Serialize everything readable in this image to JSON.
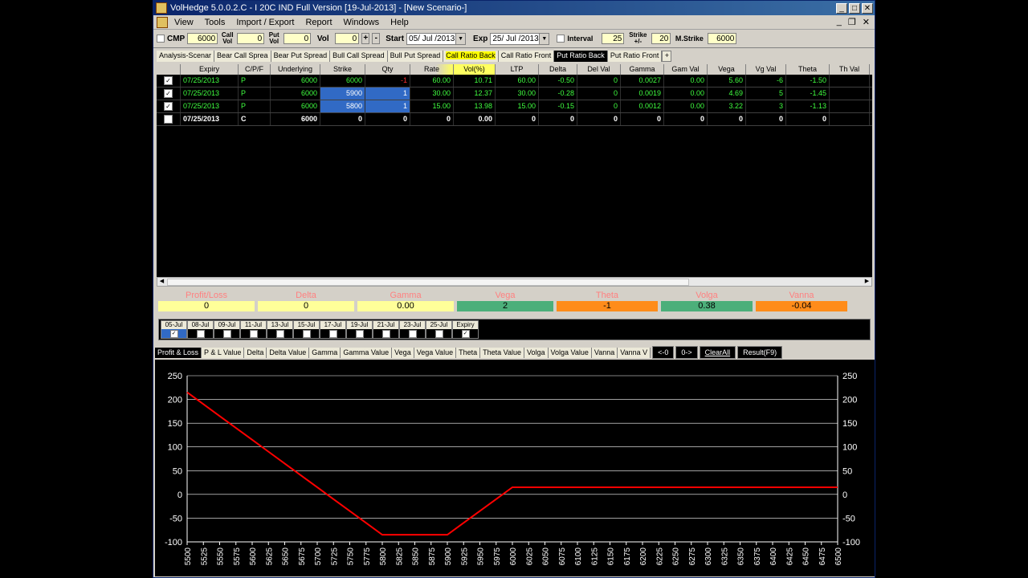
{
  "window": {
    "title": "VolHedge 5.0.0.2.C - I 20C IND Full Version  [19-Jul-2013]  - [New Scenario-]"
  },
  "menu": {
    "items": [
      "View",
      "Tools",
      "Import / Export",
      "Report",
      "Windows",
      "Help"
    ]
  },
  "toolbar": {
    "cmp_label": "CMP",
    "cmp_value": "6000",
    "callvol_label": "Call Vol",
    "callvol_value": "0",
    "putvol_label": "Put Vol",
    "putvol_value": "0",
    "vol_label": "Vol",
    "vol_value": "0",
    "plus": "+",
    "minus": "-",
    "start_label": "Start",
    "start_value": "05/ Jul /2013",
    "exp_label": "Exp",
    "exp_value": "25/ Jul /2013",
    "interval_label": "Interval",
    "interval_value": "25",
    "strike_label": "Strike +/-",
    "strike_value": "20",
    "mstrike_label": "M.Strike",
    "mstrike_value": "6000"
  },
  "strategy_tabs": [
    "Analysis-Scenar",
    "Bear Call Sprea",
    "Bear Put Spread",
    "Bull Call Spread",
    "Bull Put Spread",
    "Call Ratio Back",
    "Call Ratio Front",
    "Put Ratio Back",
    "Put Ratio Front",
    "+"
  ],
  "grid": {
    "columns": [
      "",
      "Expiry",
      "C/P/F",
      "Underlying",
      "Strike",
      "Qty",
      "Rate",
      "Vol(%)",
      "LTP",
      "Delta",
      "Del Val",
      "Gamma",
      "Gam Val",
      "Vega",
      "Vg Val",
      "Theta",
      "Th Val"
    ],
    "rows": [
      {
        "checked": true,
        "expiry": "07/25/2013",
        "cpf": "P",
        "underlying": "6000",
        "strike": "6000",
        "qty": "-1",
        "rate": "60.00",
        "vol": "10.71",
        "ltp": "60.00",
        "delta": "-0.50",
        "delval": "0",
        "gamma": "0.0027",
        "gamval": "0.00",
        "vega": "5.60",
        "vgval": "-6",
        "theta": "-1.50",
        "thval": ""
      },
      {
        "checked": true,
        "expiry": "07/25/2013",
        "cpf": "P",
        "underlying": "6000",
        "strike": "5900",
        "qty": "1",
        "rate": "30.00",
        "vol": "12.37",
        "ltp": "30.00",
        "delta": "-0.28",
        "delval": "0",
        "gamma": "0.0019",
        "gamval": "0.00",
        "vega": "4.69",
        "vgval": "5",
        "theta": "-1.45",
        "thval": ""
      },
      {
        "checked": true,
        "expiry": "07/25/2013",
        "cpf": "P",
        "underlying": "6000",
        "strike": "5800",
        "qty": "1",
        "rate": "15.00",
        "vol": "13.98",
        "ltp": "15.00",
        "delta": "-0.15",
        "delval": "0",
        "gamma": "0.0012",
        "gamval": "0.00",
        "vega": "3.22",
        "vgval": "3",
        "theta": "-1.13",
        "thval": ""
      },
      {
        "checked": false,
        "expiry": "07/25/2013",
        "cpf": "C",
        "underlying": "6000",
        "strike": "0",
        "qty": "0",
        "rate": "0",
        "vol": "0.00",
        "ltp": "0",
        "delta": "0",
        "delval": "0",
        "gamma": "0",
        "gamval": "0",
        "vega": "0",
        "vgval": "0",
        "theta": "0",
        "thval": ""
      }
    ]
  },
  "greeks": [
    {
      "label": "Profit/Loss",
      "value": "0",
      "color": "#ffff99"
    },
    {
      "label": "Delta",
      "value": "0",
      "color": "#ffff99"
    },
    {
      "label": "Gamma",
      "value": "0.00",
      "color": "#ffff99"
    },
    {
      "label": "Vega",
      "value": "2",
      "color": "#4caf7a"
    },
    {
      "label": "Theta",
      "value": "-1",
      "color": "#ff8c1a"
    },
    {
      "label": "Volga",
      "value": "0.38",
      "color": "#4caf7a"
    },
    {
      "label": "Vanna",
      "value": "-0.04",
      "color": "#ff8c1a"
    }
  ],
  "dates": [
    {
      "label": "05-Jul",
      "checked": true,
      "selected": true
    },
    {
      "label": "08-Jul",
      "checked": false
    },
    {
      "label": "09-Jul",
      "checked": false
    },
    {
      "label": "11-Jul",
      "checked": false
    },
    {
      "label": "13-Jul",
      "checked": false
    },
    {
      "label": "15-Jul",
      "checked": false
    },
    {
      "label": "17-Jul",
      "checked": false
    },
    {
      "label": "19-Jul",
      "checked": false
    },
    {
      "label": "21-Jul",
      "checked": false
    },
    {
      "label": "23-Jul",
      "checked": false
    },
    {
      "label": "25-Jul",
      "checked": false
    },
    {
      "label": "Expiry",
      "checked": true
    }
  ],
  "chart_tabs": [
    "Profit & Loss",
    "P & L Value",
    "Delta",
    "Delta Value",
    "Gamma",
    "Gamma Value",
    "Vega",
    "Vega Value",
    "Theta",
    "Theta Value",
    "Volga",
    "Volga Value",
    "Vanna",
    "Vanna V"
  ],
  "chart_buttons": {
    "prev": "<-0",
    "next": "0->",
    "clear": "ClearAll",
    "result": "Result(F9)"
  },
  "colors": {
    "line": "#ff0000",
    "axis": "#ffffff",
    "grid": "#ffffff"
  },
  "chart_data": {
    "type": "line",
    "x": [
      5500,
      5525,
      5550,
      5575,
      5600,
      5625,
      5650,
      5675,
      5700,
      5725,
      5750,
      5775,
      5800,
      5825,
      5850,
      5875,
      5900,
      5925,
      5950,
      5975,
      6000,
      6025,
      6050,
      6075,
      6100,
      6125,
      6150,
      6175,
      6200,
      6225,
      6250,
      6275,
      6300,
      6325,
      6350,
      6375,
      6400,
      6425,
      6450,
      6475,
      6500
    ],
    "series": [
      {
        "values": [
          215,
          190,
          165,
          140,
          115,
          90,
          65,
          40,
          15,
          -10,
          -35,
          -60,
          -85,
          -85,
          -85,
          -85,
          -85,
          -60,
          -35,
          -10,
          15,
          15,
          15,
          15,
          15,
          15,
          15,
          15,
          15,
          15,
          15,
          15,
          15,
          15,
          15,
          15,
          15,
          15,
          15,
          15,
          15
        ]
      }
    ],
    "ylim": [
      -100,
      250
    ],
    "yticks": [
      -100,
      -50,
      0,
      50,
      100,
      150,
      200,
      250
    ],
    "grid": true
  }
}
